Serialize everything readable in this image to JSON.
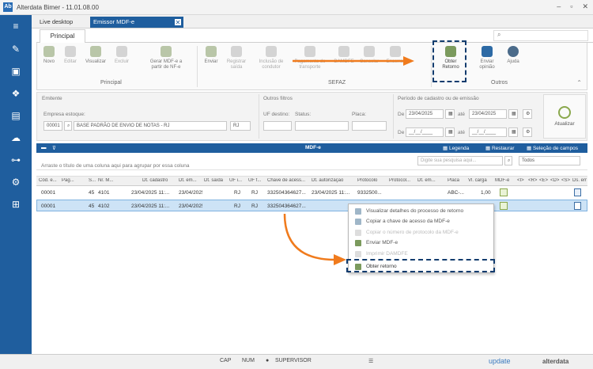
{
  "window": {
    "title": "Alterdata Bimer - 11.01.08.00",
    "app_icon": "Ab"
  },
  "doc_tabs": [
    {
      "label": "Live desktop"
    },
    {
      "label": "Emissor MDF-e"
    }
  ],
  "ribbon_tab": "Principal",
  "ribbon": {
    "principal": [
      {
        "label": "Novo"
      },
      {
        "label": "Editar"
      },
      {
        "label": "Visualizar"
      },
      {
        "label": "Excluir"
      },
      {
        "label": "Gerar MDF-e a partir de NF-e"
      }
    ],
    "sefaz": [
      {
        "label": "Enviar"
      },
      {
        "label": "Registrar saída"
      },
      {
        "label": "Inclusão de condutor"
      },
      {
        "label": "Pagamento do transporte"
      },
      {
        "label": "DAMDFE"
      },
      {
        "label": "Cancelar"
      },
      {
        "label": "Encerrar"
      }
    ],
    "outros": [
      {
        "label": "Obter Retorno"
      },
      {
        "label": "Enviar opinião"
      },
      {
        "label": "Ajuda"
      }
    ],
    "group_principal": "Principal",
    "group_sefaz": "SEFAZ",
    "group_outros": "Outros"
  },
  "filters": {
    "emitente_title": "Emitente",
    "empresa_label": "Empresa estoque:",
    "empresa_code": "00001",
    "empresa_name": "BASE PADRÃO DE ENVIO DE NOTAS - RJ",
    "empresa_uf": "RJ",
    "outros_title": "Outros filtros",
    "uf_label": "UF destino:",
    "status_label": "Status:",
    "placa_label": "Placa:",
    "periodo_title": "Período de cadastro ou de emissão",
    "de_label": "De",
    "ate_label": "até",
    "de_date": "23/04/2025",
    "ate_date": "23/04/2025",
    "de2_date": "__/__/____",
    "ate2_date": "__/__/____",
    "atualizar": "Atualizar"
  },
  "grid": {
    "title": "MDF-e",
    "legenda": "Legenda",
    "restaurar": "Restaurar",
    "selecao": "Seleção de campos",
    "group_hint": "Arraste o título de uma coluna aqui para agrupar por essa coluna",
    "search_placeholder": "Digite sua pesquisa aqui...",
    "filter_all": "Todos",
    "columns": [
      "Cód. e...",
      "Pag...",
      "S...",
      "Nr. M...",
      "Dt. cadastro",
      "Dt. em...",
      "Dt. saída",
      "UF i...",
      "UF f...",
      "Chave de acess...",
      "Dt. autorização",
      "Protocolo",
      "Protocol...",
      "Dt. em...",
      "Placa",
      "Vl. carga",
      "MDF-e",
      "<I>",
      "<R>",
      "<E>",
      "<D>",
      "<S>",
      "Ds. emi"
    ],
    "rows": [
      {
        "cod": "00001",
        "s": "45",
        "nr": "4101",
        "dt": "23/04/2025 11:...",
        "dt2": "23/04/2025 ...",
        "uf_i": "RJ",
        "uf_f": "RJ",
        "chave": "332504364627...",
        "aut": "23/04/2025 11:...",
        "prot": "9332500...",
        "placa": "ABC-...",
        "valor": "1,00"
      },
      {
        "cod": "00001",
        "s": "45",
        "nr": "4102",
        "dt": "23/04/2025 11:...",
        "dt2": "23/04/2025 ...",
        "uf_i": "RJ",
        "uf_f": "RJ",
        "chave": "332504364627..."
      }
    ]
  },
  "context_menu": [
    {
      "label": "Visualizar detalhes do processo de retorno",
      "enabled": true
    },
    {
      "label": "Copiar a chave de acesso da MDF-e",
      "enabled": true
    },
    {
      "label": "Copiar o número de protocolo da MDF-e",
      "enabled": false
    },
    {
      "label": "Enviar MDF-e",
      "enabled": true
    },
    {
      "label": "Imprimir DAMDFE",
      "enabled": false
    },
    {
      "label": "Obter retorno",
      "enabled": true
    }
  ],
  "status": {
    "cap": "CAP",
    "num": "NUM",
    "user": "SUPERVISOR",
    "update": "update",
    "brand": "alterdata"
  },
  "colors": {
    "accent": "#1f5e9e",
    "highlight": "#123c6e",
    "arrow": "#f07b1d"
  }
}
